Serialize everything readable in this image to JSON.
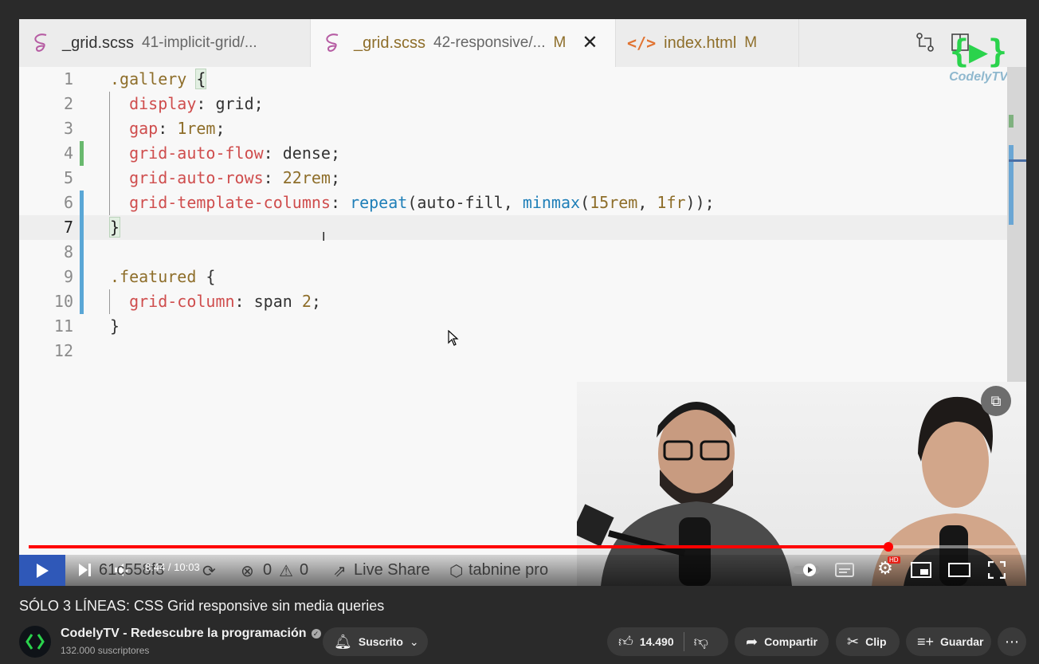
{
  "tabs": [
    {
      "file": "_grid.scss",
      "desc": "41-implicit-grid/...",
      "mod": "",
      "close": ""
    },
    {
      "file": "_grid.scss",
      "desc": "42-responsive/...",
      "mod": "M",
      "close": "✕"
    },
    {
      "file": "index.html",
      "desc": "",
      "mod": "M",
      "close": ""
    }
  ],
  "html_icon": "</>",
  "toolbar_icons": [
    "git-compare-icon",
    "split-editor-icon"
  ],
  "logo": {
    "brace": "{▶}",
    "name": "CodelyTV"
  },
  "code_lines": [
    {
      "n": "1",
      "parts": [
        {
          "t": ".gallery",
          "c": "sel"
        },
        {
          "t": " ",
          "c": ""
        },
        {
          "t": "{",
          "c": "brk"
        }
      ]
    },
    {
      "n": "2",
      "parts": [
        {
          "t": "  ",
          "c": ""
        },
        {
          "t": "display",
          "c": "prop"
        },
        {
          "t": ": grid;",
          "c": ""
        }
      ]
    },
    {
      "n": "3",
      "parts": [
        {
          "t": "  ",
          "c": ""
        },
        {
          "t": "gap",
          "c": "prop"
        },
        {
          "t": ": ",
          "c": ""
        },
        {
          "t": "1rem",
          "c": "num"
        },
        {
          "t": ";",
          "c": ""
        }
      ]
    },
    {
      "n": "4",
      "parts": [
        {
          "t": "  ",
          "c": ""
        },
        {
          "t": "grid-auto-flow",
          "c": "prop"
        },
        {
          "t": ": dense;",
          "c": ""
        }
      ]
    },
    {
      "n": "5",
      "parts": [
        {
          "t": "  ",
          "c": ""
        },
        {
          "t": "grid-auto-rows",
          "c": "prop"
        },
        {
          "t": ": ",
          "c": ""
        },
        {
          "t": "22rem",
          "c": "num"
        },
        {
          "t": ";",
          "c": ""
        }
      ]
    },
    {
      "n": "6",
      "parts": [
        {
          "t": "  ",
          "c": ""
        },
        {
          "t": "grid-template-columns",
          "c": "prop"
        },
        {
          "t": ": ",
          "c": ""
        },
        {
          "t": "repeat",
          "c": "fn"
        },
        {
          "t": "(auto-fill, ",
          "c": ""
        },
        {
          "t": "minmax",
          "c": "fn"
        },
        {
          "t": "(",
          "c": ""
        },
        {
          "t": "15rem",
          "c": "num"
        },
        {
          "t": ", ",
          "c": ""
        },
        {
          "t": "1fr",
          "c": "num"
        },
        {
          "t": "));",
          "c": ""
        }
      ]
    },
    {
      "n": "7",
      "parts": [
        {
          "t": "}",
          "c": "brk"
        }
      ]
    },
    {
      "n": "8",
      "parts": []
    },
    {
      "n": "9",
      "parts": [
        {
          "t": ".featured",
          "c": "sel"
        },
        {
          "t": " {",
          "c": ""
        }
      ]
    },
    {
      "n": "10",
      "parts": [
        {
          "t": "  ",
          "c": ""
        },
        {
          "t": "grid-column",
          "c": "prop"
        },
        {
          "t": ": span ",
          "c": ""
        },
        {
          "t": "2",
          "c": "num"
        },
        {
          "t": ";",
          "c": ""
        }
      ]
    },
    {
      "n": "11",
      "parts": [
        {
          "t": "}",
          "c": ""
        }
      ]
    },
    {
      "n": "12",
      "parts": []
    }
  ],
  "current_line": 7,
  "gutter_colors": {
    "added": "#69b96e",
    "modified": "#5aa7d6"
  },
  "statusbar": {
    "commit": "61c558f3",
    "errors": "0",
    "warnings": "0",
    "live_share": "Live Share",
    "tabnine": "tabnine pro"
  },
  "player": {
    "time": "8:44 / 10:03",
    "progress": 0.87,
    "hd_badge": "HD",
    "accent": "#ff0000"
  },
  "video": {
    "title": "SÓLO 3 LÍNEAS: CSS Grid responsive sin media queries",
    "channel": "CodelyTV - Redescubre la programación",
    "subscribers": "132.000 suscriptores"
  },
  "actions": {
    "subscribed": "Suscrito",
    "likes": "14.490",
    "share": "Compartir",
    "clip": "Clip",
    "save": "Guardar"
  }
}
